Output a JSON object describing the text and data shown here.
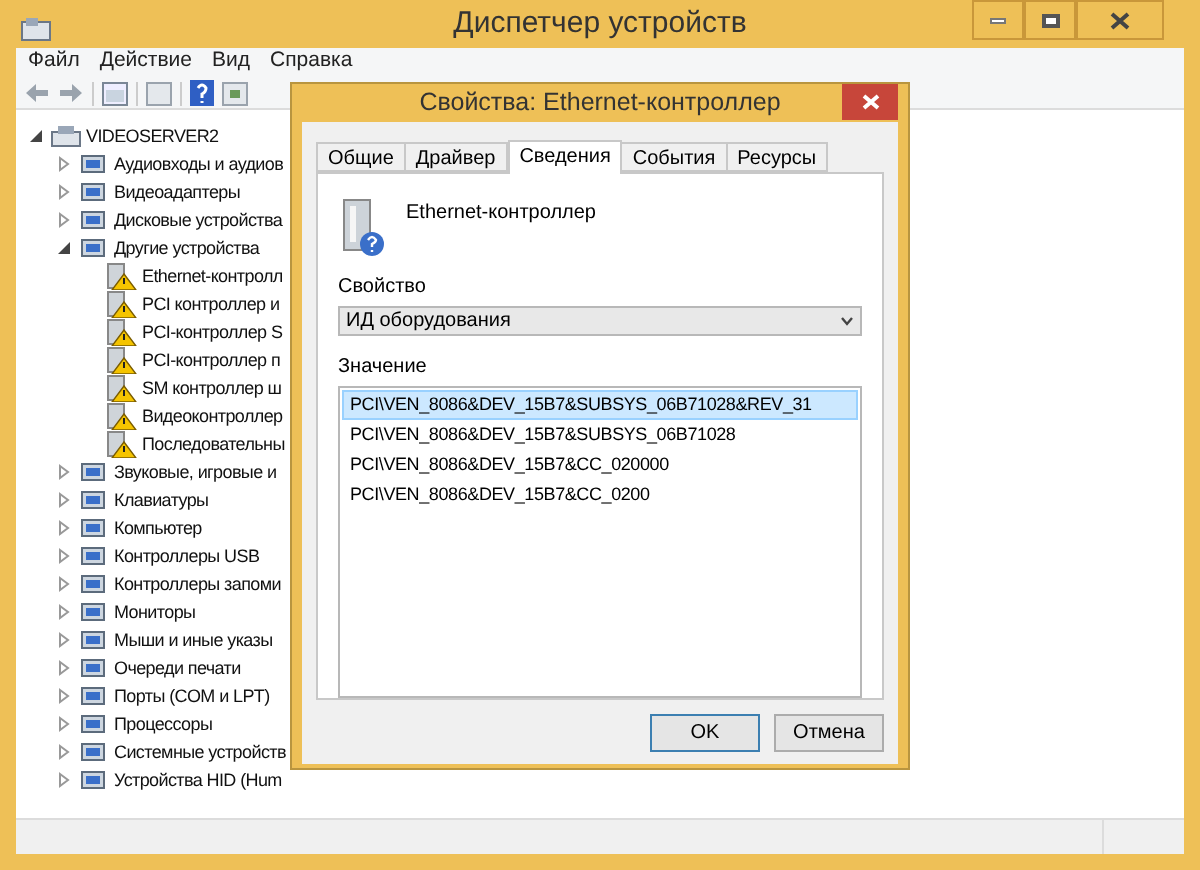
{
  "window": {
    "title": "Диспетчер устройств"
  },
  "menu": [
    "Файл",
    "Действие",
    "Вид",
    "Справка"
  ],
  "tree": {
    "label": "VIDEOSERVER2",
    "expanded": true,
    "children": [
      {
        "label": "Аудиовходы и аудиов",
        "expanded": false
      },
      {
        "label": "Видеоадаптеры",
        "expanded": false
      },
      {
        "label": "Дисковые устройства",
        "expanded": false
      },
      {
        "label": "Другие устройства",
        "expanded": true,
        "children": [
          {
            "label": "Ethernet-контролл",
            "warning": true
          },
          {
            "label": "PCI контроллер и",
            "warning": true
          },
          {
            "label": "PCI-контроллер S",
            "warning": true
          },
          {
            "label": "PCI-контроллер п",
            "warning": true
          },
          {
            "label": "SM контроллер ш",
            "warning": true
          },
          {
            "label": "Видеоконтроллер",
            "warning": true
          },
          {
            "label": "Последовательны",
            "warning": true
          }
        ]
      },
      {
        "label": "Звуковые, игровые и",
        "expanded": false
      },
      {
        "label": "Клавиатуры",
        "expanded": false
      },
      {
        "label": "Компьютер",
        "expanded": false
      },
      {
        "label": "Контроллеры USB",
        "expanded": false
      },
      {
        "label": "Контроллеры запоми",
        "expanded": false
      },
      {
        "label": "Мониторы",
        "expanded": false
      },
      {
        "label": "Мыши и иные указы",
        "expanded": false
      },
      {
        "label": "Очереди печати",
        "expanded": false
      },
      {
        "label": "Порты (COM и LPT)",
        "expanded": false
      },
      {
        "label": "Процессоры",
        "expanded": false
      },
      {
        "label": "Системные устройств",
        "expanded": false
      },
      {
        "label": "Устройства HID (Hum",
        "expanded": false
      }
    ]
  },
  "dialog": {
    "title": "Свойства: Ethernet-контроллер",
    "tabs": [
      {
        "label": "Общие",
        "selected": false
      },
      {
        "label": "Драйвер",
        "selected": false
      },
      {
        "label": "Сведения",
        "selected": true
      },
      {
        "label": "События",
        "selected": false
      },
      {
        "label": "Ресурсы",
        "selected": false
      }
    ],
    "device_name": "Ethernet-контроллер",
    "property_label": "Свойство",
    "property_value": "ИД оборудования",
    "value_label": "Значение",
    "values": [
      {
        "text": "PCI\\VEN_8086&DEV_15B7&SUBSYS_06B71028&REV_31",
        "selected": true
      },
      {
        "text": "PCI\\VEN_8086&DEV_15B7&SUBSYS_06B71028",
        "selected": false
      },
      {
        "text": "PCI\\VEN_8086&DEV_15B7&CC_020000",
        "selected": false
      },
      {
        "text": "PCI\\VEN_8086&DEV_15B7&CC_0200",
        "selected": false
      }
    ],
    "buttons": [
      {
        "label": "OK",
        "default": true
      },
      {
        "label": "Отмена",
        "default": false
      }
    ]
  }
}
